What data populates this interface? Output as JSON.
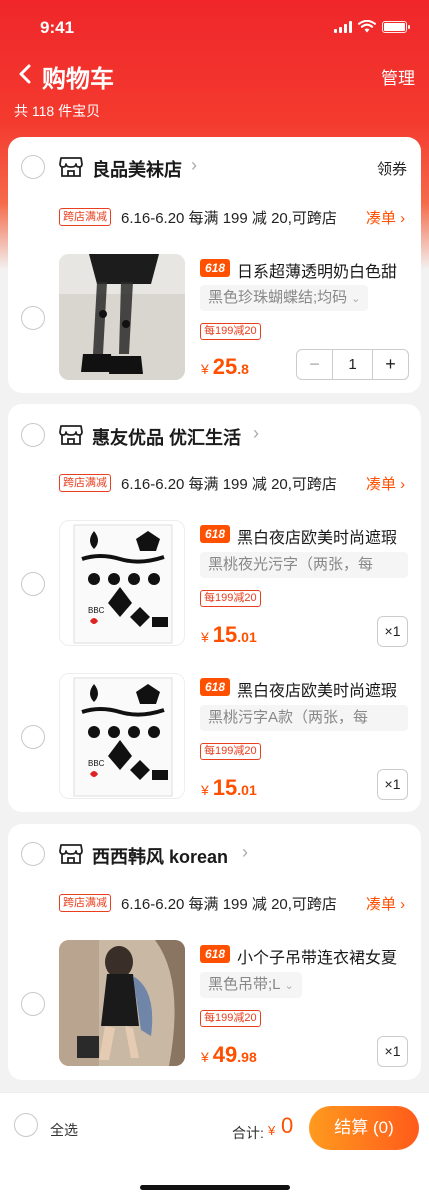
{
  "status": {
    "time": "9:41"
  },
  "nav": {
    "back_icon": "chevron-left-icon",
    "title": "购物车",
    "manage": "管理"
  },
  "summary": {
    "total_items": "共 118 件宝贝"
  },
  "stores": [
    {
      "name": "良品美袜店",
      "coupon": "领券",
      "promo_tag": "跨店满减",
      "promo_text": "6.16-6.20 每满 199 减 20,可跨店",
      "promo_link": "凑单 ›",
      "items": [
        {
          "badge": "618",
          "title": "日系超薄透明奶白色甜",
          "sku": "黑色珍珠蝴蝶结;均码",
          "discount": "每199减20",
          "price_currency": "¥",
          "price_int": "25",
          "price_dec": ".8",
          "quantity": "1"
        }
      ]
    },
    {
      "name": "惠友优品 优汇生活",
      "promo_tag": "跨店满减",
      "promo_text": "6.16-6.20 每满 199 减 20,可跨店",
      "promo_link": "凑单 ›",
      "items": [
        {
          "badge": "618",
          "title": "黑白夜店欧美时尚遮瑕",
          "sku": "黑桃夜光污字（两张，每",
          "discount": "每199减20",
          "price_currency": "¥",
          "price_int": "15",
          "price_dec": ".01",
          "quantity": "×1"
        },
        {
          "badge": "618",
          "title": "黑白夜店欧美时尚遮瑕",
          "sku": "黑桃污字A款（两张，每",
          "discount": "每199减20",
          "price_currency": "¥",
          "price_int": "15",
          "price_dec": ".01",
          "quantity": "×1"
        }
      ]
    },
    {
      "name": "西西韩风 korean",
      "promo_tag": "跨店满减",
      "promo_text": "6.16-6.20 每满 199 减 20,可跨店",
      "promo_link": "凑单 ›",
      "items": [
        {
          "badge": "618",
          "title": "小个子吊带连衣裙女夏",
          "sku": "黑色吊带;L",
          "discount": "每199减20",
          "price_currency": "¥",
          "price_int": "49",
          "price_dec": ".98",
          "quantity": "×1"
        }
      ]
    }
  ],
  "bottom": {
    "select_all": "全选",
    "total_label": "合计:",
    "total_currency": "¥",
    "total_value": "0",
    "checkout": "结算 (0)"
  },
  "colors": {
    "brand_red": "#f0262a",
    "price_orange": "#ff5000"
  }
}
